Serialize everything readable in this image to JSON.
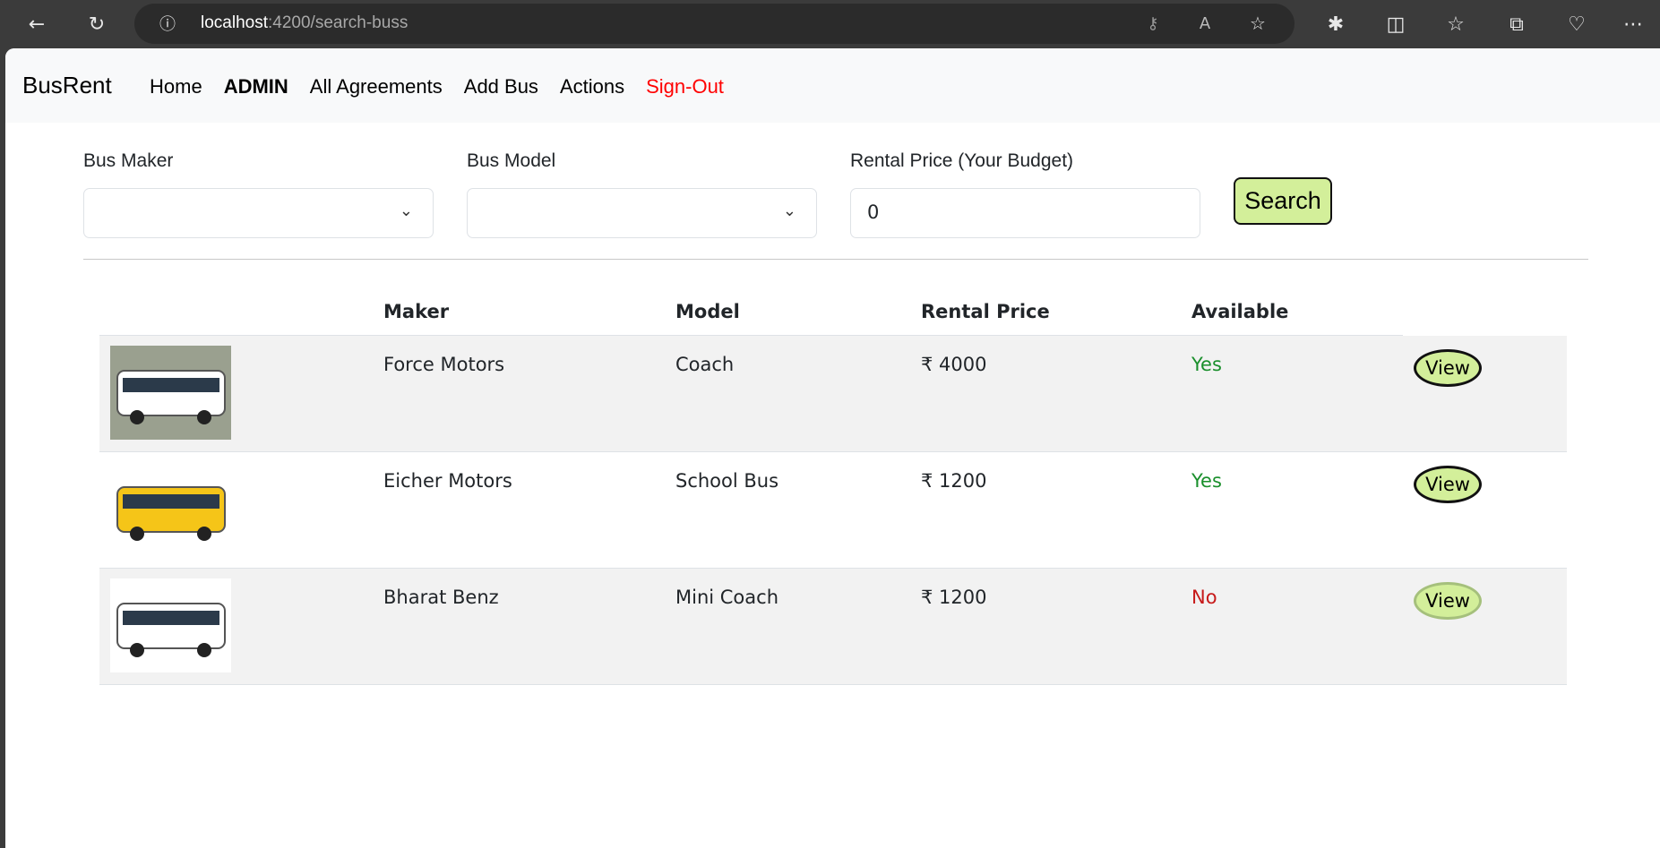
{
  "browser": {
    "url_host": "localhost",
    "url_rest": ":4200/search-buss"
  },
  "navbar": {
    "brand": "BusRent",
    "links": [
      "Home",
      "ADMIN",
      "All Agreements",
      "Add Bus",
      "Actions",
      "Sign-Out"
    ]
  },
  "form": {
    "maker_label": "Bus Maker",
    "maker_value": "",
    "model_label": "Bus Model",
    "model_value": "",
    "price_label": "Rental Price (Your Budget)",
    "price_value": "0",
    "search_label": "Search"
  },
  "table": {
    "headers": [
      "",
      "Maker",
      "Model",
      "Rental Price",
      "Available",
      ""
    ],
    "rows": [
      {
        "maker": "Force Motors",
        "model": "Coach",
        "price": "₹ 4000",
        "available": "Yes",
        "action": "View",
        "bus_color": "#ffffff"
      },
      {
        "maker": "Eicher Motors",
        "model": "School Bus",
        "price": "₹ 1200",
        "available": "Yes",
        "action": "View",
        "bus_color": "#f5c518"
      },
      {
        "maker": "Bharat Benz",
        "model": "Mini Coach",
        "price": "₹ 1200",
        "available": "No",
        "action": "View",
        "bus_color": "#ffffff"
      }
    ]
  },
  "colors": {
    "accent_button": "#d3ef9a",
    "sign_out": "#ff0000",
    "available_yes": "#198f2b",
    "available_no": "#c71a1a"
  }
}
